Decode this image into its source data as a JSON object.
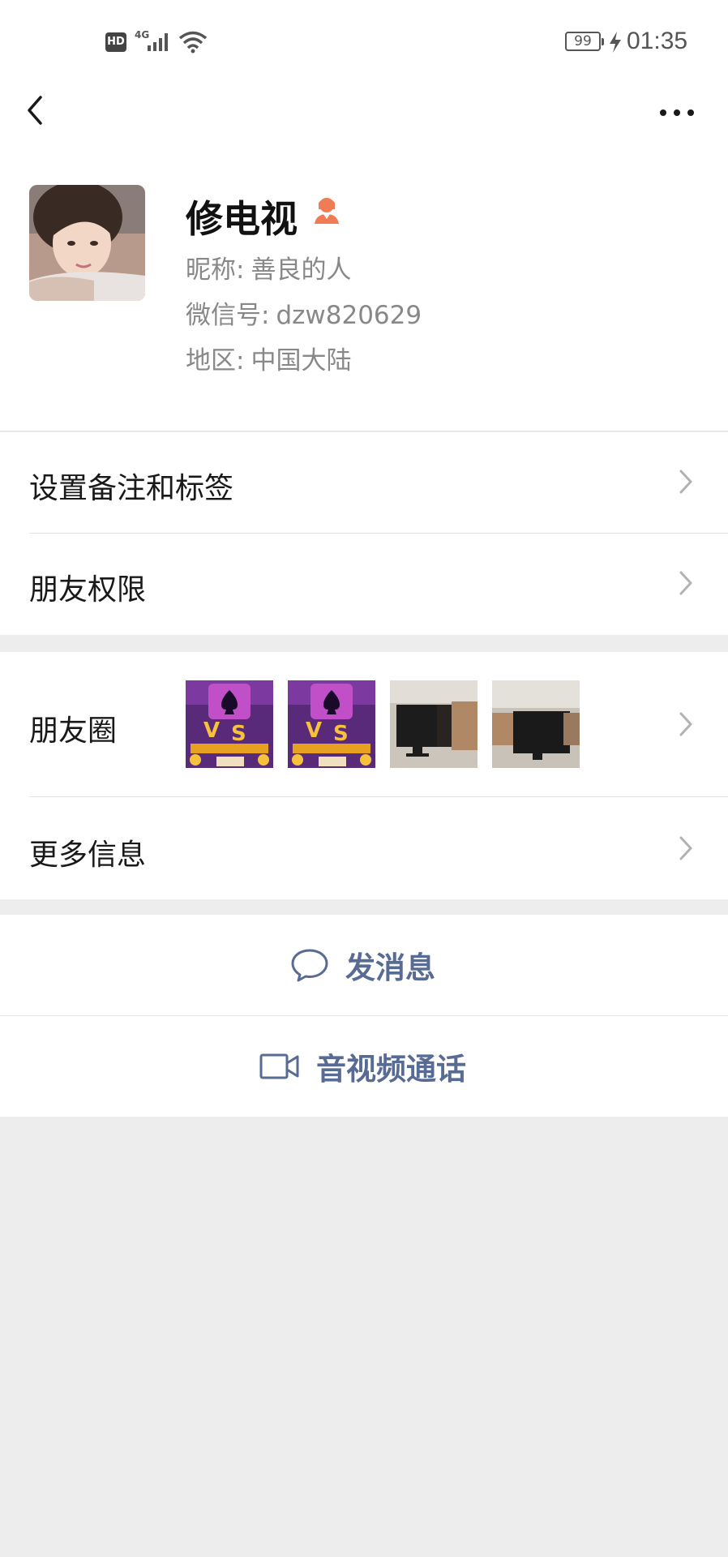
{
  "status_bar": {
    "hd": "HD",
    "network": "4G",
    "battery": "99",
    "time": "01:35"
  },
  "profile": {
    "display_name": "修电视",
    "nickname_label": "昵称:",
    "nickname": "善良的人",
    "wechat_id_label": "微信号:",
    "wechat_id": "dzw820629",
    "region_label": "地区:",
    "region": "中国大陆"
  },
  "menu": {
    "remarks_tags": "设置备注和标签",
    "friend_permissions": "朋友权限",
    "moments": "朋友圈",
    "more_info": "更多信息"
  },
  "actions": {
    "send_message": "发消息",
    "video_call": "音视频通话"
  },
  "icons": {
    "back": "back-arrow-icon",
    "more": "more-dots-icon",
    "gender": "female-user-icon",
    "chevron": "chevron-right-icon",
    "message": "chat-bubble-icon",
    "video": "video-camera-icon"
  },
  "colors": {
    "link_blue": "#576b95",
    "gender_orange": "#f07c54",
    "background": "#ededed"
  }
}
